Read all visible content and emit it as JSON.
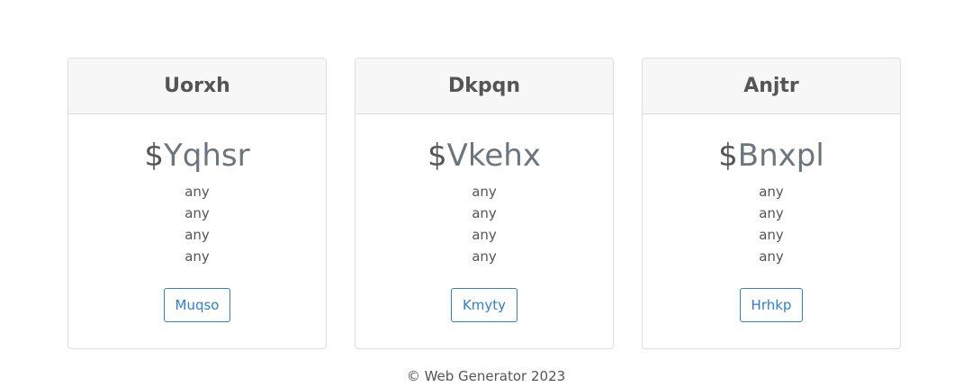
{
  "plans": [
    {
      "title": "Uorxh",
      "currency": "$",
      "price": "Yqhsr",
      "features": [
        "any",
        "any",
        "any",
        "any"
      ],
      "button_label": "Muqso"
    },
    {
      "title": "Dkpqn",
      "currency": "$",
      "price": "Vkehx",
      "features": [
        "any",
        "any",
        "any",
        "any"
      ],
      "button_label": "Kmyty"
    },
    {
      "title": "Anjtr",
      "currency": "$",
      "price": "Bnxpl",
      "features": [
        "any",
        "any",
        "any",
        "any"
      ],
      "button_label": "Hrhkp"
    }
  ],
  "footer": {
    "text": "© Web Generator 2023"
  },
  "colors": {
    "accent": "#2f7fd0",
    "header_bg": "#f7f7f7",
    "border": "#dddddd"
  }
}
